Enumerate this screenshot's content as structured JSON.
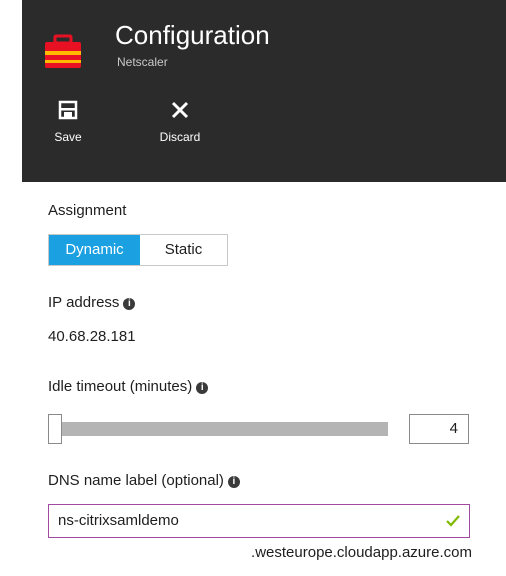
{
  "header": {
    "title": "Configuration",
    "subtitle": "Netscaler",
    "icon": "toolbox-icon",
    "commands": {
      "save": {
        "label": "Save",
        "icon": "save-icon"
      },
      "discard": {
        "label": "Discard",
        "icon": "close-icon"
      }
    }
  },
  "assignment": {
    "label": "Assignment",
    "options": [
      "Dynamic",
      "Static"
    ],
    "selected": "Dynamic"
  },
  "ip_address": {
    "label": "IP address",
    "value": "40.68.28.181"
  },
  "idle_timeout": {
    "label": "Idle timeout (minutes)",
    "value": "4"
  },
  "dns_label": {
    "label": "DNS name label (optional)",
    "value": "ns-citrixsamldemo",
    "suffix": ".westeurope.cloudapp.azure.com",
    "valid": true
  },
  "colors": {
    "header_bg": "#2b2b2b",
    "accent": "#1ba1e2",
    "field_border": "#a24aa0",
    "valid_check": "#7fba00",
    "icon_red": "#e81123"
  }
}
